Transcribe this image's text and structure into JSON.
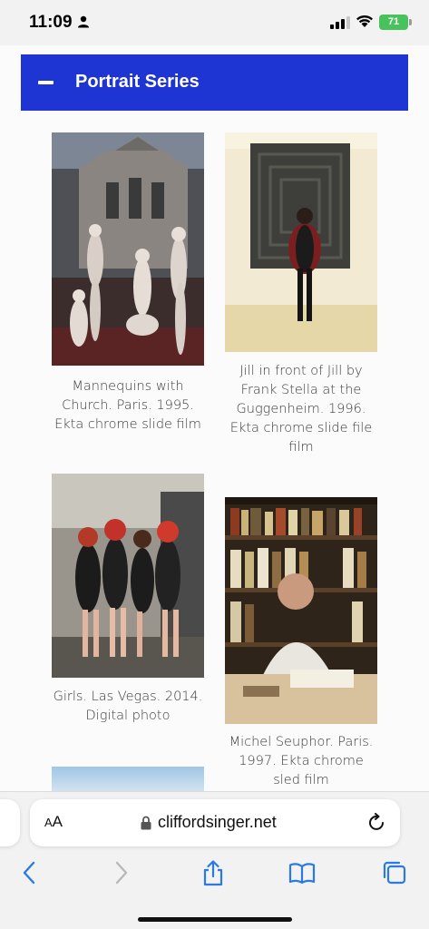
{
  "status_bar": {
    "time": "11:09",
    "battery": "71",
    "icons": [
      "person-icon",
      "cellular-signal-icon",
      "wifi-icon",
      "battery-icon"
    ]
  },
  "accordion": {
    "title": "Portrait Series",
    "icon": "minus-icon"
  },
  "gallery": {
    "items": [
      {
        "caption_lines": [
          "Mannequins with",
          "Church. Paris. 1995.",
          "Ekta chrome slide film"
        ]
      },
      {
        "caption_lines": [
          "Jill in front of Jill by",
          "Frank Stella at the",
          "Guggenheim. 1996.",
          "Ekta chrome slide file",
          "film"
        ]
      },
      {
        "caption_lines": [
          "Girls. Las Vegas. 2014.",
          "Digital photo"
        ]
      },
      {
        "caption_lines": [
          "Michel Seuphor. Paris.",
          "1997. Ekta chrome",
          "sled film"
        ]
      }
    ]
  },
  "browser": {
    "aa_label_big": "A",
    "aa_label_small": "A",
    "url": "cliffordsinger.net",
    "toolbar_icons": [
      "back-icon",
      "forward-icon",
      "share-icon",
      "bookmarks-icon",
      "tabs-icon"
    ],
    "colors": {
      "accent": "#1f35d3",
      "toolbar_blue": "#2a7ae2"
    }
  }
}
